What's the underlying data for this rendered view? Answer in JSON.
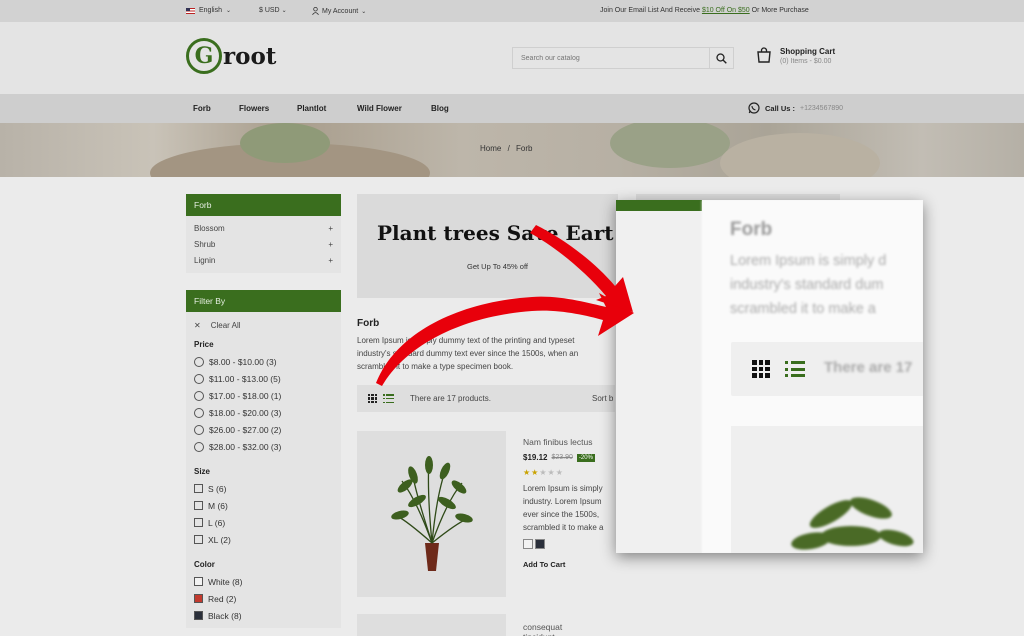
{
  "topbar": {
    "language": "English",
    "currency": "$ USD",
    "account": "My Account",
    "promo_prefix": "Join Our Email List And Receive ",
    "promo_highlight": "$10 Off On $50",
    "promo_suffix": " Or More Purchase"
  },
  "header": {
    "logo_letter": "G",
    "logo_word": "root",
    "search_placeholder": "Search our catalog",
    "cart_title": "Shopping Cart",
    "cart_summary": "(0) Items - $0.00"
  },
  "nav": {
    "items": [
      "Forb",
      "Flowers",
      "Plantlot",
      "Wild Flower",
      "Blog"
    ],
    "call_label": "Call Us :",
    "call_number": "+1234567890"
  },
  "breadcrumb": {
    "home": "Home",
    "sep": "/",
    "current": "Forb"
  },
  "sidebar": {
    "category_title": "Forb",
    "categories": [
      {
        "label": "Blossom",
        "toggle": "+"
      },
      {
        "label": "Shrub",
        "toggle": "+"
      },
      {
        "label": "Lignin",
        "toggle": "+"
      }
    ],
    "filter_title": "Filter By",
    "clear_all": "Clear All",
    "price_title": "Price",
    "prices": [
      "$8.00 - $10.00 (3)",
      "$11.00 - $13.00 (5)",
      "$17.00 - $18.00 (1)",
      "$18.00 - $20.00 (3)",
      "$26.00 - $27.00 (2)",
      "$28.00 - $32.00 (3)"
    ],
    "size_title": "Size",
    "sizes": [
      "S (6)",
      "M (6)",
      "L (6)",
      "XL (2)"
    ],
    "color_title": "Color",
    "colors": [
      {
        "label": "White (8)",
        "hex": "#f2f2f2"
      },
      {
        "label": "Red (2)",
        "hex": "#c23a2e"
      },
      {
        "label": "Black (8)",
        "hex": "#2a2f3a"
      }
    ]
  },
  "main": {
    "banner_headline": "Plant trees Save Eart",
    "banner_sub": "Get Up To 45% off",
    "category_title": "Forb",
    "category_desc_lines": [
      "Lorem Ipsum is simply dummy text of the printing and typeset",
      "industry's standard dummy text ever since the 1500s, when an",
      "scrambled it to make a type specimen book."
    ],
    "product_count": "There are 17 products.",
    "sort_label": "Sort b",
    "products": [
      {
        "name": "Nam finibus lectus",
        "price": "$19.12",
        "old_price": "$23.90",
        "discount": "-20%",
        "rating": 2,
        "max_rating": 5,
        "desc_lines": [
          "Lorem Ipsum is simply",
          "industry. Lorem Ipsum",
          "ever since the 1500s,",
          "scrambled it to make a"
        ],
        "swatches": [
          "#f2f2f2",
          "#2a2f3a"
        ],
        "add_to_cart": "Add To Cart"
      },
      {
        "name": "consequat tincidunt"
      }
    ]
  },
  "zoom": {
    "title": "Forb",
    "desc_lines": [
      "Lorem Ipsum is simply d",
      "industry's standard dum",
      "scrambled it to make a"
    ],
    "count": "There are 17"
  },
  "colors": {
    "accent": "#3a6e1e",
    "arrow": "#e8000b"
  }
}
